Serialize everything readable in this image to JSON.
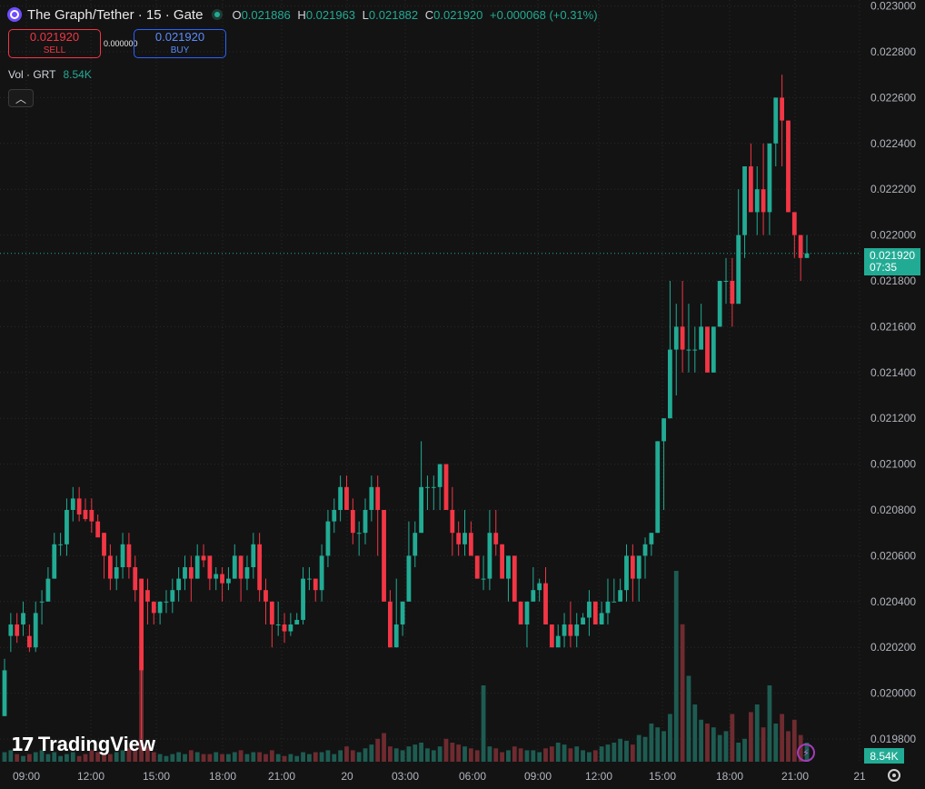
{
  "header": {
    "title": "The Graph/Tether · 15 · Gate",
    "open_label": "O",
    "open": "0.021886",
    "high_label": "H",
    "high": "0.021963",
    "low_label": "L",
    "low": "0.021882",
    "close_label": "C",
    "close": "0.021920",
    "change": "+0.000068 (+0.31%)"
  },
  "trade": {
    "sell_price": "0.021920",
    "sell_label": "SELL",
    "spread": "0.000000",
    "buy_price": "0.021920",
    "buy_label": "BUY"
  },
  "volume_legend": {
    "label": "Vol · GRT",
    "value": "8.54K"
  },
  "price_axis": [
    "0.023000",
    "0.022800",
    "0.022600",
    "0.022400",
    "0.022200",
    "0.022000",
    "0.021800",
    "0.021600",
    "0.021400",
    "0.021200",
    "0.021000",
    "0.020800",
    "0.020600",
    "0.020400",
    "0.020200",
    "0.020000",
    "0.019800"
  ],
  "time_axis": [
    "09:00",
    "12:00",
    "15:00",
    "18:00",
    "21:00",
    "20",
    "03:00",
    "06:00",
    "09:00",
    "12:00",
    "15:00",
    "18:00",
    "21:00",
    "21"
  ],
  "last_price": {
    "price": "0.021920",
    "countdown": "07:35"
  },
  "volume_tag": "8.54K",
  "branding": "TradingView",
  "icons": {
    "logo": "the-graph-logo-icon",
    "status": "market-open-dot-icon",
    "collapse": "chevron-up-icon",
    "bolt": "lightning-icon",
    "settings": "gear-icon"
  },
  "colors": {
    "up": "#22ab94",
    "down": "#f23645",
    "background": "#131313",
    "grid": "#2a2a2a"
  },
  "chart_data": {
    "type": "candlestick",
    "interval": "15",
    "ylim": [
      0.0197,
      0.023
    ],
    "grid": true,
    "candles": [
      [
        0.0199,
        0.02015,
        0.0199,
        0.0201
      ],
      [
        0.02025,
        0.02035,
        0.02018,
        0.0203
      ],
      [
        0.0203,
        0.02035,
        0.02022,
        0.02025
      ],
      [
        0.0203,
        0.0204,
        0.02025,
        0.02035
      ],
      [
        0.02025,
        0.0203,
        0.02018,
        0.0202
      ],
      [
        0.0202,
        0.0204,
        0.02018,
        0.02035
      ],
      [
        0.0204,
        0.02045,
        0.0203,
        0.0204
      ],
      [
        0.0204,
        0.02055,
        0.0204,
        0.0205
      ],
      [
        0.0205,
        0.0207,
        0.0205,
        0.02065
      ],
      [
        0.02065,
        0.0207,
        0.0206,
        0.02065
      ],
      [
        0.02065,
        0.02085,
        0.0206,
        0.0208
      ],
      [
        0.0208,
        0.0209,
        0.02075,
        0.02085
      ],
      [
        0.02085,
        0.0209,
        0.02075,
        0.02078
      ],
      [
        0.0208,
        0.02085,
        0.02075,
        0.02076
      ],
      [
        0.0208,
        0.02085,
        0.0207,
        0.02075
      ],
      [
        0.02075,
        0.02078,
        0.0207,
        0.02068
      ],
      [
        0.0207,
        0.0207,
        0.0205,
        0.0206
      ],
      [
        0.0206,
        0.02065,
        0.02045,
        0.0205
      ],
      [
        0.0205,
        0.0206,
        0.02045,
        0.02055
      ],
      [
        0.02055,
        0.0207,
        0.0205,
        0.02065
      ],
      [
        0.02065,
        0.0207,
        0.0205,
        0.02055
      ],
      [
        0.02055,
        0.0206,
        0.0204,
        0.02045
      ],
      [
        0.0205,
        0.0205,
        0.0198,
        0.0201
      ],
      [
        0.02045,
        0.0205,
        0.0203,
        0.0204
      ],
      [
        0.0204,
        0.0204,
        0.0203,
        0.02035
      ],
      [
        0.02035,
        0.0204,
        0.0203,
        0.0204
      ],
      [
        0.0204,
        0.02045,
        0.02035,
        0.0204
      ],
      [
        0.0204,
        0.0205,
        0.02035,
        0.02045
      ],
      [
        0.02045,
        0.02055,
        0.0204,
        0.0205
      ],
      [
        0.0205,
        0.0206,
        0.02045,
        0.02055
      ],
      [
        0.02055,
        0.0206,
        0.0204,
        0.0205
      ],
      [
        0.0205,
        0.02065,
        0.0205,
        0.0206
      ],
      [
        0.0206,
        0.02065,
        0.02055,
        0.02058
      ],
      [
        0.0206,
        0.0206,
        0.02045,
        0.0205
      ],
      [
        0.0205,
        0.02055,
        0.02045,
        0.02052
      ],
      [
        0.02052,
        0.02055,
        0.0204,
        0.02048
      ],
      [
        0.02048,
        0.02055,
        0.02045,
        0.0205
      ],
      [
        0.0205,
        0.02065,
        0.0205,
        0.0206
      ],
      [
        0.0206,
        0.0206,
        0.0204,
        0.0205
      ],
      [
        0.0205,
        0.0206,
        0.02045,
        0.02055
      ],
      [
        0.02055,
        0.0207,
        0.0205,
        0.02065
      ],
      [
        0.02065,
        0.0207,
        0.0204,
        0.02045
      ],
      [
        0.02045,
        0.0205,
        0.0203,
        0.0204
      ],
      [
        0.0204,
        0.0204,
        0.0202,
        0.0203
      ],
      [
        0.0203,
        0.0204,
        0.02025,
        0.0203
      ],
      [
        0.0203,
        0.02035,
        0.02022,
        0.02027
      ],
      [
        0.02027,
        0.02035,
        0.02025,
        0.0203
      ],
      [
        0.0203,
        0.02035,
        0.0203,
        0.02032
      ],
      [
        0.02032,
        0.02055,
        0.0203,
        0.0205
      ],
      [
        0.0205,
        0.02055,
        0.02045,
        0.0205
      ],
      [
        0.0205,
        0.0205,
        0.0204,
        0.02045
      ],
      [
        0.02045,
        0.02065,
        0.0204,
        0.0206
      ],
      [
        0.0206,
        0.0208,
        0.02055,
        0.02075
      ],
      [
        0.02075,
        0.02085,
        0.0207,
        0.0208
      ],
      [
        0.0208,
        0.02095,
        0.02075,
        0.0209
      ],
      [
        0.0209,
        0.02095,
        0.0208,
        0.0208
      ],
      [
        0.0208,
        0.02085,
        0.02065,
        0.0207
      ],
      [
        0.0207,
        0.02075,
        0.0206,
        0.0207
      ],
      [
        0.0207,
        0.02085,
        0.02065,
        0.0208
      ],
      [
        0.0208,
        0.02095,
        0.02075,
        0.0209
      ],
      [
        0.0209,
        0.02095,
        0.0206,
        0.0208
      ],
      [
        0.0208,
        0.0208,
        0.0204,
        0.0204
      ],
      [
        0.0204,
        0.02045,
        0.0202,
        0.0202
      ],
      [
        0.0202,
        0.0205,
        0.0202,
        0.0203
      ],
      [
        0.0203,
        0.0204,
        0.02025,
        0.0204
      ],
      [
        0.0204,
        0.02075,
        0.0204,
        0.0206
      ],
      [
        0.0206,
        0.02075,
        0.02055,
        0.0207
      ],
      [
        0.0207,
        0.0211,
        0.0207,
        0.0209
      ],
      [
        0.0209,
        0.02095,
        0.0208,
        0.0209
      ],
      [
        0.0209,
        0.02095,
        0.0208,
        0.0209
      ],
      [
        0.0209,
        0.021,
        0.0208,
        0.021
      ],
      [
        0.021,
        0.021,
        0.0208,
        0.0208
      ],
      [
        0.0208,
        0.0209,
        0.0206,
        0.0207
      ],
      [
        0.0207,
        0.02075,
        0.0206,
        0.02065
      ],
      [
        0.02065,
        0.0208,
        0.0206,
        0.0207
      ],
      [
        0.0207,
        0.02075,
        0.0206,
        0.0206
      ],
      [
        0.0206,
        0.0206,
        0.0205,
        0.0205
      ],
      [
        0.0205,
        0.0206,
        0.02045,
        0.0205
      ],
      [
        0.0205,
        0.0208,
        0.02045,
        0.0207
      ],
      [
        0.0207,
        0.0208,
        0.0206,
        0.02065
      ],
      [
        0.02065,
        0.02065,
        0.0205,
        0.0205
      ],
      [
        0.0205,
        0.0206,
        0.0204,
        0.0206
      ],
      [
        0.0206,
        0.0206,
        0.0204,
        0.0204
      ],
      [
        0.0204,
        0.0204,
        0.0203,
        0.0203
      ],
      [
        0.0203,
        0.0204,
        0.0202,
        0.0204
      ],
      [
        0.0204,
        0.02055,
        0.0204,
        0.02045
      ],
      [
        0.02045,
        0.0205,
        0.0204,
        0.02048
      ],
      [
        0.02048,
        0.02055,
        0.0203,
        0.0203
      ],
      [
        0.0203,
        0.0203,
        0.0202,
        0.0202
      ],
      [
        0.0202,
        0.0203,
        0.0202,
        0.02025
      ],
      [
        0.02025,
        0.02035,
        0.0202,
        0.0203
      ],
      [
        0.0203,
        0.0204,
        0.0202,
        0.02025
      ],
      [
        0.02025,
        0.02035,
        0.0202,
        0.0203
      ],
      [
        0.0203,
        0.02035,
        0.0203,
        0.02033
      ],
      [
        0.02033,
        0.02045,
        0.02025,
        0.0204
      ],
      [
        0.0204,
        0.0204,
        0.0203,
        0.0203
      ],
      [
        0.0203,
        0.0204,
        0.0203,
        0.02035
      ],
      [
        0.02035,
        0.0205,
        0.0203,
        0.0204
      ],
      [
        0.0204,
        0.0205,
        0.0204,
        0.0204
      ],
      [
        0.0204,
        0.0205,
        0.0204,
        0.02045
      ],
      [
        0.02045,
        0.02065,
        0.0204,
        0.0206
      ],
      [
        0.0206,
        0.02065,
        0.0204,
        0.0205
      ],
      [
        0.0205,
        0.0206,
        0.0204,
        0.0206
      ],
      [
        0.0206,
        0.02068,
        0.0205,
        0.02065
      ],
      [
        0.02065,
        0.0207,
        0.0206,
        0.0207
      ],
      [
        0.0207,
        0.0211,
        0.0207,
        0.0211
      ],
      [
        0.0211,
        0.0212,
        0.0208,
        0.0212
      ],
      [
        0.0212,
        0.0218,
        0.0212,
        0.0215
      ],
      [
        0.0215,
        0.0217,
        0.0213,
        0.0216
      ],
      [
        0.0216,
        0.0218,
        0.0214,
        0.0215
      ],
      [
        0.0215,
        0.0217,
        0.0214,
        0.0215
      ],
      [
        0.0215,
        0.0216,
        0.0214,
        0.0215
      ],
      [
        0.0215,
        0.0217,
        0.0215,
        0.0216
      ],
      [
        0.0216,
        0.0216,
        0.0214,
        0.0214
      ],
      [
        0.0214,
        0.0216,
        0.0214,
        0.0216
      ],
      [
        0.0216,
        0.0218,
        0.0216,
        0.0218
      ],
      [
        0.0218,
        0.0219,
        0.0217,
        0.0218
      ],
      [
        0.0218,
        0.0219,
        0.0216,
        0.0217
      ],
      [
        0.0217,
        0.0222,
        0.0217,
        0.022
      ],
      [
        0.022,
        0.0223,
        0.0219,
        0.0223
      ],
      [
        0.0223,
        0.0224,
        0.0221,
        0.0221
      ],
      [
        0.0221,
        0.0223,
        0.022,
        0.0222
      ],
      [
        0.0222,
        0.0224,
        0.022,
        0.0221
      ],
      [
        0.0221,
        0.0224,
        0.022,
        0.0224
      ],
      [
        0.0224,
        0.0226,
        0.0223,
        0.0226
      ],
      [
        0.0226,
        0.0227,
        0.0223,
        0.0225
      ],
      [
        0.0225,
        0.0225,
        0.0221,
        0.0221
      ],
      [
        0.0221,
        0.0221,
        0.0219,
        0.022
      ],
      [
        0.022,
        0.022,
        0.0218,
        0.0219
      ],
      [
        0.0219,
        0.022,
        0.0219,
        0.02192
      ]
    ],
    "volume_scale_max": 100,
    "volumes": [
      5,
      6,
      4,
      3,
      4,
      5,
      6,
      4,
      5,
      3,
      4,
      5,
      3,
      4,
      6,
      5,
      4,
      4,
      5,
      6,
      7,
      6,
      56,
      8,
      5,
      4,
      3,
      4,
      5,
      4,
      6,
      5,
      4,
      4,
      5,
      4,
      4,
      5,
      6,
      4,
      5,
      5,
      4,
      6,
      4,
      3,
      4,
      3,
      5,
      4,
      5,
      5,
      6,
      4,
      6,
      8,
      6,
      5,
      7,
      9,
      12,
      15,
      8,
      7,
      6,
      8,
      9,
      10,
      7,
      6,
      8,
      12,
      10,
      9,
      8,
      7,
      6,
      40,
      8,
      7,
      5,
      6,
      8,
      7,
      6,
      6,
      5,
      7,
      8,
      10,
      9,
      7,
      8,
      6,
      5,
      6,
      8,
      9,
      10,
      12,
      11,
      9,
      14,
      13,
      20,
      18,
      16,
      25,
      100,
      72,
      45,
      30,
      22,
      20,
      18,
      14,
      16,
      25,
      10,
      12,
      26,
      30,
      18,
      40,
      20,
      25,
      16,
      22,
      14,
      10,
      12,
      20,
      22,
      8,
      30
    ]
  }
}
